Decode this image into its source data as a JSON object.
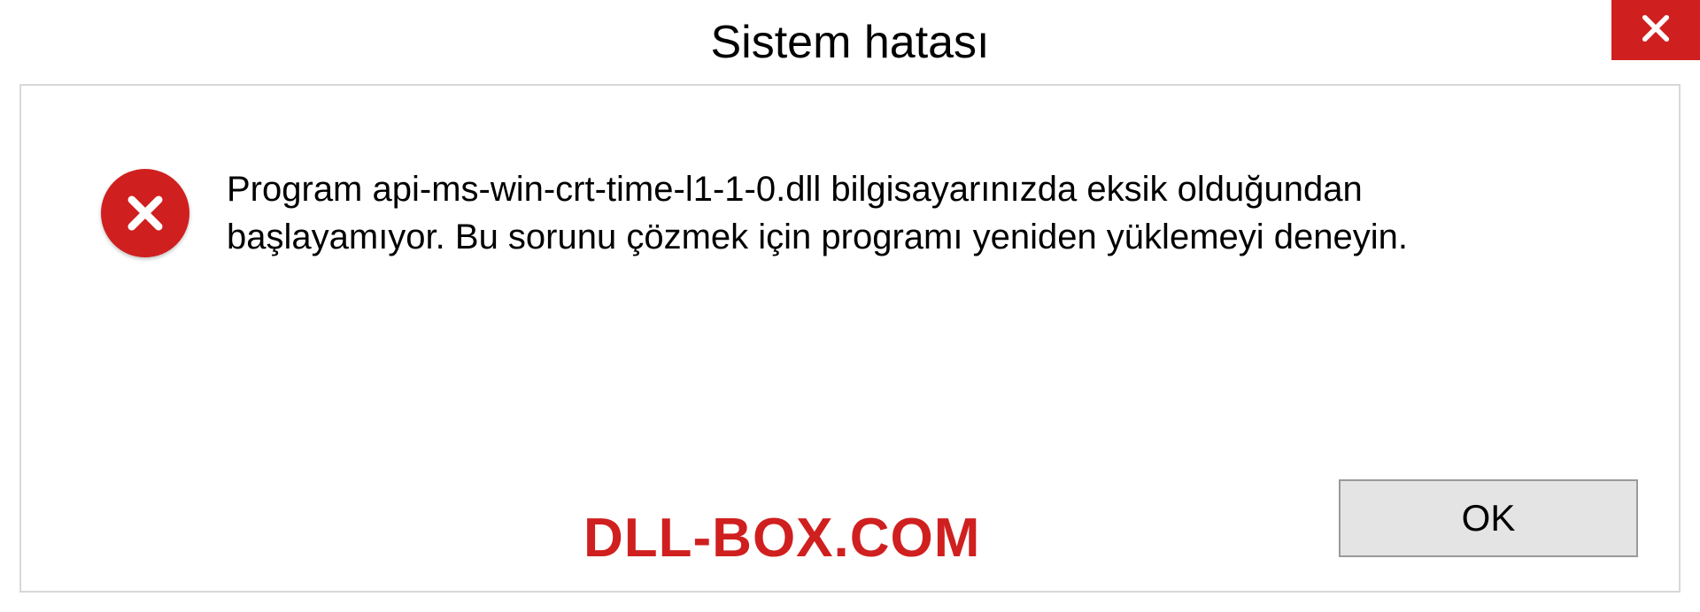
{
  "dialog": {
    "title": "Sistem hatası",
    "message": "Program api-ms-win-crt-time-l1-1-0.dll bilgisayarınızda eksik olduğundan başlayamıyor. Bu sorunu çözmek için programı yeniden yüklemeyi deneyin.",
    "ok_label": "OK",
    "watermark": "DLL-BOX.COM"
  },
  "colors": {
    "error_red": "#d01f1f",
    "border_gray": "#d8d8d8",
    "button_bg": "#e4e4e4",
    "button_border": "#9a9a9a"
  }
}
